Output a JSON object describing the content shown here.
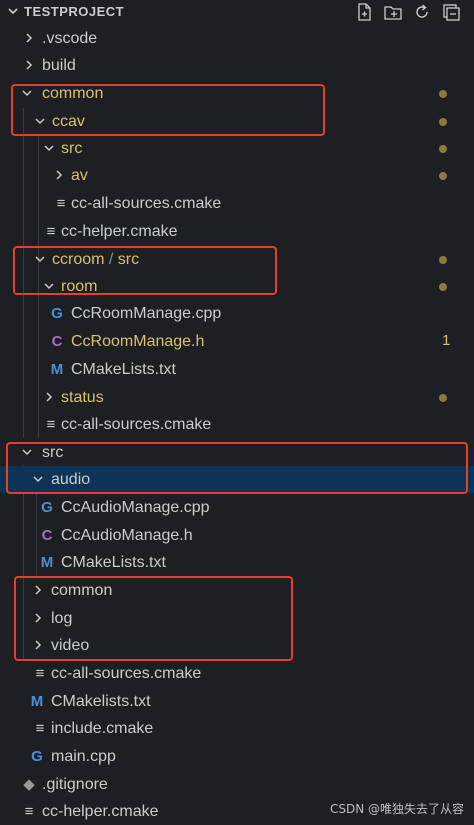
{
  "explorer": {
    "title": "TESTPROJECT",
    "actions": {
      "new_file_icon": "new-file-icon",
      "new_folder_icon": "new-folder-icon",
      "refresh_icon": "refresh-icon",
      "collapse_icon": "collapse-all-icon"
    }
  },
  "tree": [
    {
      "name": ".vscode",
      "type": "folder",
      "expanded": false
    },
    {
      "name": "build",
      "type": "folder",
      "expanded": false
    },
    {
      "name": "common",
      "type": "folder",
      "expanded": true,
      "modified": true
    },
    {
      "name": "ccav",
      "type": "folder",
      "expanded": true,
      "modified": true
    },
    {
      "name": "src",
      "type": "folder",
      "expanded": true,
      "modified": true
    },
    {
      "name": "av",
      "type": "folder",
      "expanded": false,
      "modified": true
    },
    {
      "name": "cc-all-sources.cmake",
      "type": "file",
      "icon": "≡"
    },
    {
      "name": "cc-helper.cmake",
      "type": "file",
      "icon": "≡"
    },
    {
      "name": "ccroom",
      "name_suffix": "src",
      "type": "folder",
      "expanded": true,
      "modified": true
    },
    {
      "name": "room",
      "type": "folder",
      "expanded": true,
      "modified": true
    },
    {
      "name": "CcRoomManage.cpp",
      "type": "file",
      "icon": "G"
    },
    {
      "name": "CcRoomManage.h",
      "type": "file",
      "icon": "C",
      "badge": "1"
    },
    {
      "name": "CMakeLists.txt",
      "type": "file",
      "icon": "M"
    },
    {
      "name": "status",
      "type": "folder",
      "expanded": false,
      "modified": true
    },
    {
      "name": "cc-all-sources.cmake",
      "type": "file",
      "icon": "≡"
    },
    {
      "name": "src",
      "type": "folder",
      "expanded": true
    },
    {
      "name": "audio",
      "type": "folder",
      "expanded": true,
      "selected": true
    },
    {
      "name": "CcAudioManage.cpp",
      "type": "file",
      "icon": "G"
    },
    {
      "name": "CcAudioManage.h",
      "type": "file",
      "icon": "C"
    },
    {
      "name": "CMakeLists.txt",
      "type": "file",
      "icon": "M"
    },
    {
      "name": "common",
      "type": "folder",
      "expanded": false
    },
    {
      "name": "log",
      "type": "folder",
      "expanded": false
    },
    {
      "name": "video",
      "type": "folder",
      "expanded": false
    },
    {
      "name": "cc-all-sources.cmake",
      "type": "file",
      "icon": "≡"
    },
    {
      "name": "CMakelists.txt",
      "type": "file",
      "icon": "M"
    },
    {
      "name": "include.cmake",
      "type": "file",
      "icon": "≡"
    },
    {
      "name": "main.cpp",
      "type": "file",
      "icon": "G"
    },
    {
      "name": ".gitignore",
      "type": "file",
      "icon": "◆"
    },
    {
      "name": "cc-helper.cmake",
      "type": "file",
      "icon": "≡"
    }
  ],
  "watermark": "CSDN @唯独失去了从容",
  "colors": {
    "modified_text": "#d8c072",
    "normal_text": "#cccccc",
    "selection_bg": "#0b3456",
    "annotation_red": "#e2412e",
    "cpp_icon": "#4a90d9",
    "h_icon": "#a074c4",
    "cmake_icon": "#4a90d9"
  }
}
